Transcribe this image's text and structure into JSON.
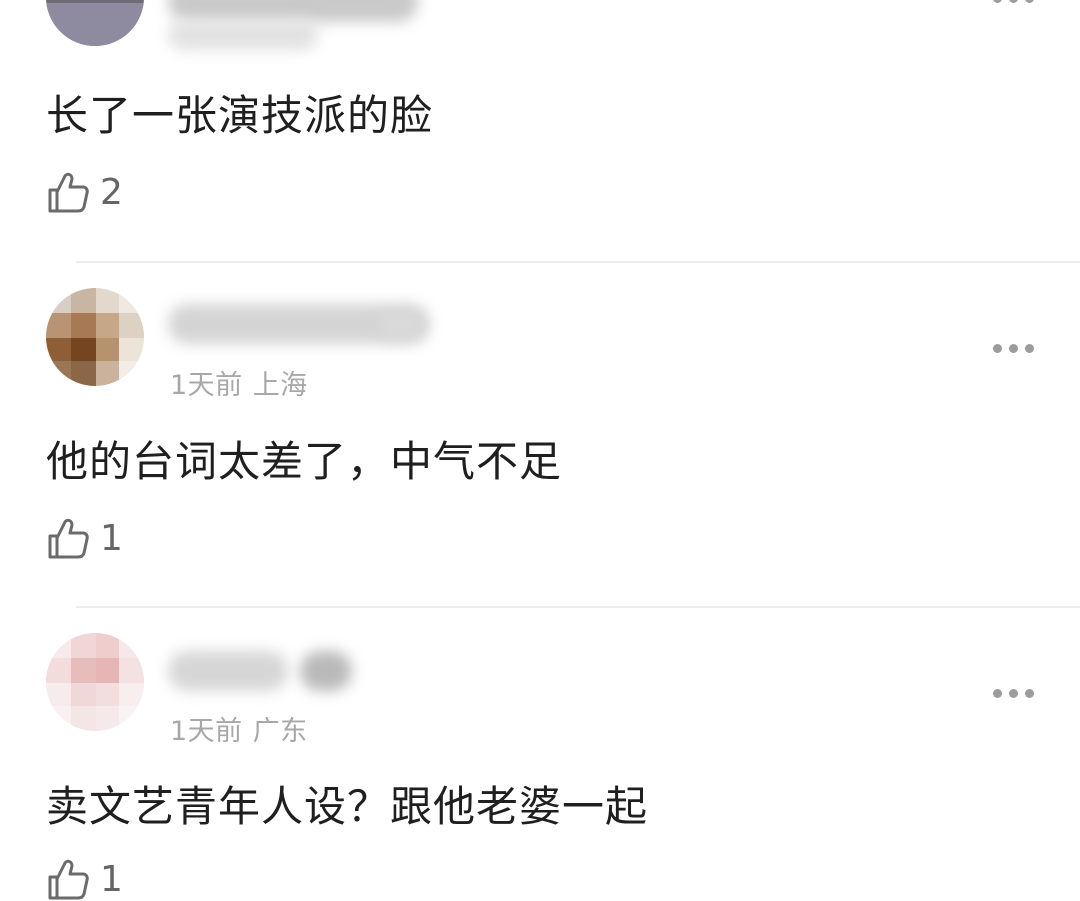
{
  "comments": [
    {
      "text": "长了一张演技派的脸",
      "like_count": "2"
    },
    {
      "time": "1天前",
      "location": "上海",
      "text": "他的台词太差了，中气不足",
      "like_count": "1"
    },
    {
      "time": "1天前",
      "location": "广东",
      "text": "卖文艺青年人设？跟他老婆一起",
      "like_count": "1"
    }
  ],
  "icons": {
    "like": "thumbs-up-icon",
    "more": "more-dots-icon"
  },
  "colors": {
    "text": "#1f1f1f",
    "meta": "#a8a8a8",
    "icon": "#6b6b6b",
    "divider": "#ededed"
  }
}
